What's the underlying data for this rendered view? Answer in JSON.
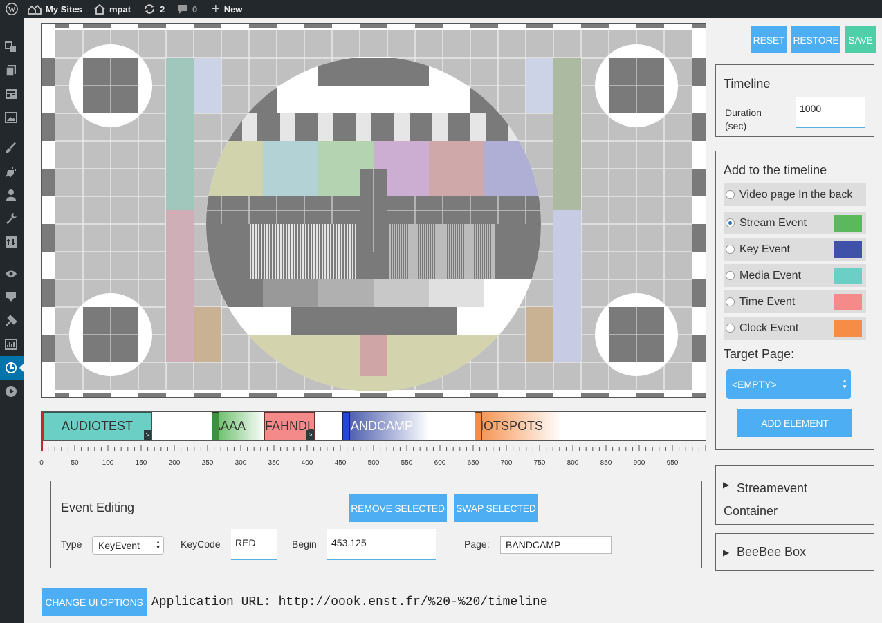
{
  "adminbar": {
    "my_sites": "My Sites",
    "site_name": "mpat",
    "updates_count": "2",
    "comments_count": "0",
    "new_label": "New"
  },
  "sidebar_icons": [
    "dashboard-icon",
    "pages-icon",
    "layouts-icon",
    "media-icon",
    "appearance-icon",
    "plugins-icon",
    "users-icon",
    "tools-icon",
    "settings-icon",
    "preview-icon",
    "import-icon",
    "build-icon",
    "stats-icon",
    "timeline-icon",
    "play-icon"
  ],
  "top_buttons": {
    "reset": "RESET",
    "restore": "RESTORE",
    "save": "SAVE"
  },
  "timeline_panel": {
    "title": "Timeline",
    "duration_label": "Duration\n(sec)",
    "duration_value": "1000"
  },
  "add_panel": {
    "title": "Add to the timeline",
    "options": [
      {
        "label": "Video page In the back",
        "selected": false,
        "color": ""
      },
      {
        "label": "Stream Event",
        "selected": true,
        "color": "#5cb85c"
      },
      {
        "label": "Key Event",
        "selected": false,
        "color": "#3f51a8"
      },
      {
        "label": "Media Event",
        "selected": false,
        "color": "#6ccfc6"
      },
      {
        "label": "Time Event",
        "selected": false,
        "color": "#f48a8a"
      },
      {
        "label": "Clock Event",
        "selected": false,
        "color": "#f58d47"
      }
    ],
    "target_label": "Target Page:",
    "target_value": "<EMPTY>",
    "add_button": "ADD ELEMENT"
  },
  "streamevent_panel": {
    "title": "Streamevent\nContainer"
  },
  "beebee_panel": {
    "title": "BeeBee Box"
  },
  "events": [
    {
      "label": "AUDIOTEST",
      "begin": 0,
      "end": 167
    },
    {
      "label": "AAAA",
      "begin": 256,
      "end": 336
    },
    {
      "label": "FAHNDL",
      "begin": 336,
      "end": 411
    },
    {
      "label": "BANDCAMP",
      "begin": 453,
      "end": 580
    },
    {
      "label": "HOTSPOTS",
      "begin": 651,
      "end": 780
    }
  ],
  "ruler_labels": [
    "0",
    "50",
    "100",
    "150",
    "200",
    "250",
    "300",
    "350",
    "400",
    "450",
    "500",
    "550",
    "600",
    "650",
    "700",
    "750",
    "800",
    "850",
    "900",
    "950"
  ],
  "event_editing": {
    "title": "Event Editing",
    "remove_button": "REMOVE SELECTED",
    "swap_button": "SWAP SELECTED",
    "type_label": "Type",
    "type_value": "KeyEvent",
    "keycode_label": "KeyCode",
    "keycode_value": "RED",
    "begin_label": "Begin",
    "begin_value": "453,125",
    "page_label": "Page:",
    "page_value": "BANDCAMP"
  },
  "footer": {
    "ui_button": "CHANGE UI OPTIONS",
    "app_url": "Application URL: http://oook.enst.fr/%20-%20/timeline"
  },
  "colors": {
    "accent": "#4daef4",
    "save": "#4ecfa8",
    "adminbar": "#23282d"
  }
}
